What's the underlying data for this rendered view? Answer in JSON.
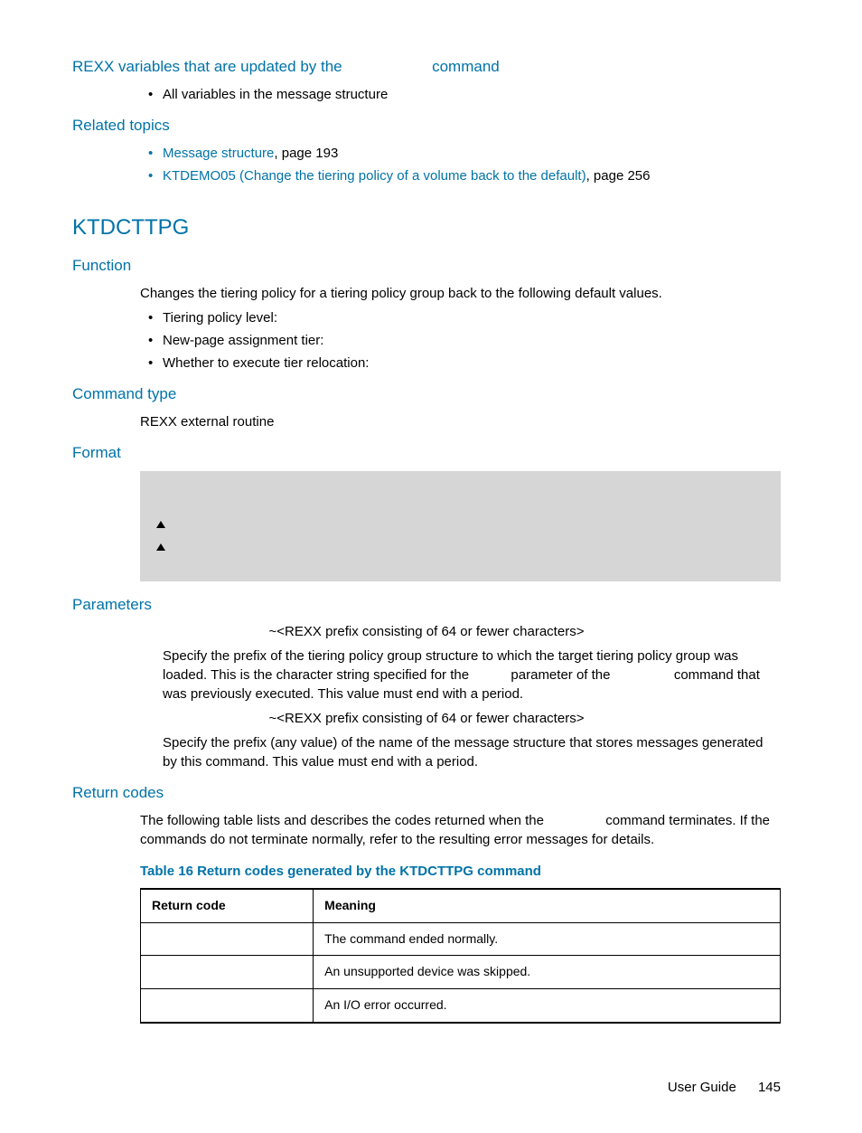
{
  "sec1": {
    "title_a": "REXX variables that are updated by the ",
    "title_b": " command",
    "bullet1": "All variables in the message structure"
  },
  "sec2": {
    "title": "Related topics",
    "link1": "Message structure",
    "link1_suffix": ", page 193",
    "link2": "KTDEMO05 (Change the tiering policy of a volume back to the default)",
    "link2_suffix": ", page 256"
  },
  "ktd": {
    "title": "KTDCTTPG",
    "func": {
      "heading": "Function",
      "intro": "Changes the tiering policy for a tiering policy group back to the following default values.",
      "b1": "Tiering policy level:",
      "b2": "New-page assignment tier:",
      "b3": "Whether to execute tier relocation:"
    },
    "cmdtype": {
      "heading": "Command type",
      "text": "REXX external routine"
    },
    "format": {
      "heading": "Format"
    },
    "params": {
      "heading": "Parameters",
      "p1_head": "~<REXX prefix consisting of 64 or fewer characters>",
      "p1_a": "Specify the prefix of the tiering policy group structure to which the target tiering policy group was loaded. This is the character string specified for the ",
      "p1_b": " parameter of the ",
      "p1_c": " command that was previously executed. This value must end with a period.",
      "p2_head": "~<REXX prefix consisting of 64 or fewer characters>",
      "p2_text": "Specify the prefix (any value) of the name of the message structure that stores messages generated by this command. This value must end with a period."
    },
    "ret": {
      "heading": "Return codes",
      "intro_a": "The following table lists and describes the codes returned when the ",
      "intro_b": " command terminates. If the commands do not terminate normally, refer to the resulting error messages for details.",
      "caption": "Table 16 Return codes generated by the KTDCTTPG command",
      "col1": "Return code",
      "col2": "Meaning",
      "rows": [
        {
          "code": "",
          "meaning": "The command ended normally."
        },
        {
          "code": "",
          "meaning": "An unsupported device was skipped."
        },
        {
          "code": "",
          "meaning": "An I/O error occurred."
        }
      ]
    }
  },
  "footer": {
    "label": "User Guide",
    "page": "145"
  }
}
